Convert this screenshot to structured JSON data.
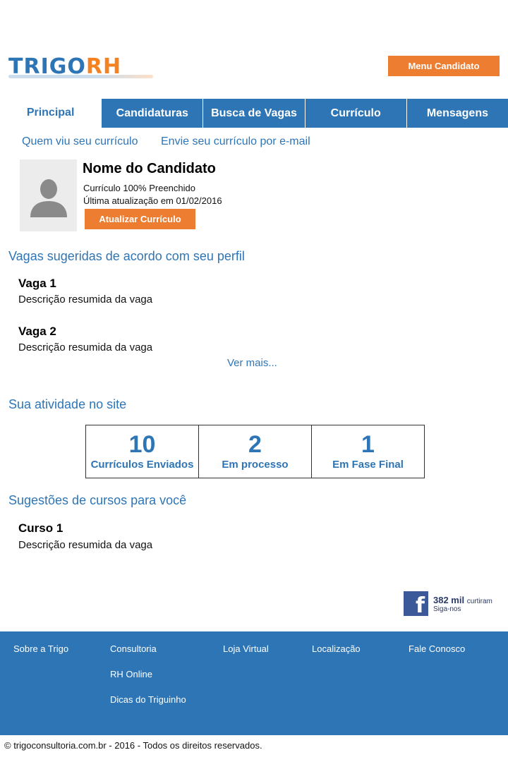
{
  "header": {
    "logo_trigo": "TRIGO",
    "logo_rh": "RH",
    "menu_button": "Menu Candidato"
  },
  "tabs": [
    {
      "label": "Principal",
      "active": true
    },
    {
      "label": "Candidaturas",
      "active": false
    },
    {
      "label": "Busca de Vagas",
      "active": false
    },
    {
      "label": "Currículo",
      "active": false
    },
    {
      "label": "Mensagens",
      "active": false
    }
  ],
  "sublinks": [
    "Quem viu seu currículo",
    "Envie seu currículo por e-mail"
  ],
  "profile": {
    "name": "Nome do Candidato",
    "completion": "Currículo 100% Preenchido",
    "last_update": "Última atualização em 01/02/2016",
    "update_button": "Atualizar Currículo"
  },
  "suggested_jobs": {
    "title": "Vagas sugeridas de acordo com seu perfil",
    "items": [
      {
        "title": "Vaga 1",
        "description": "Descrição resumida da vaga"
      },
      {
        "title": "Vaga 2",
        "description": "Descrição resumida da vaga"
      }
    ],
    "more_link": "Ver mais..."
  },
  "activity": {
    "title": "Sua atividade no site",
    "stats": [
      {
        "value": "10",
        "label": "Currículos Enviados"
      },
      {
        "value": "2",
        "label": "Em processo"
      },
      {
        "value": "1",
        "label": "Em Fase Final"
      }
    ]
  },
  "courses": {
    "title": "Sugestões de cursos para você",
    "items": [
      {
        "title": "Curso 1",
        "description": "Descrição resumida da vaga"
      }
    ]
  },
  "facebook": {
    "count": "382 mil",
    "count_suffix": "curtiram",
    "follow": "Siga-nos",
    "icon": "facebook-icon"
  },
  "footer": {
    "links": [
      "Sobre a Trigo",
      "Consultoria",
      "Loja Virtual",
      "Localização",
      "Fale Conosco",
      "RH Online",
      "Dicas do Triguinho"
    ],
    "copyright": "© trigoconsultoria.com.br - 2016 - Todos os direitos reservados."
  },
  "colors": {
    "brand_blue": "#2E75B6",
    "brand_orange": "#ED7D31",
    "facebook_blue": "#3B5998"
  }
}
